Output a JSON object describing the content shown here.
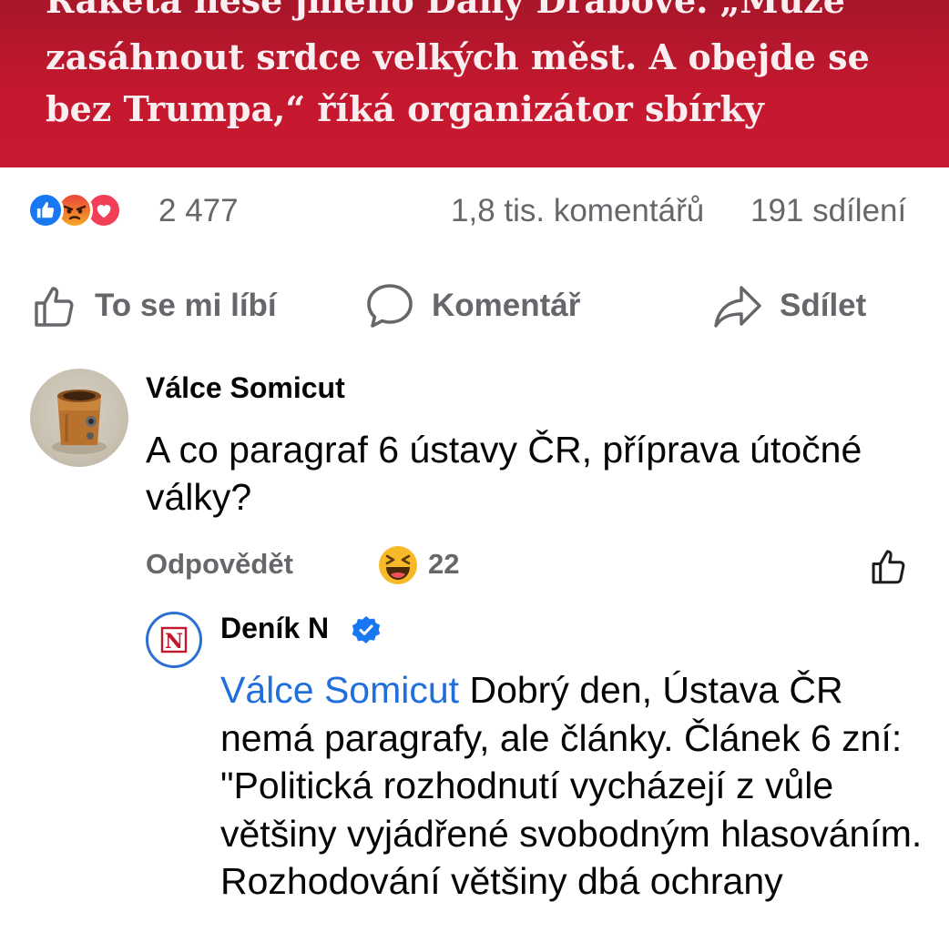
{
  "headline": {
    "lines": [
      "Raketa nese jméno Dany Drábové. „Může",
      "zasáhnout srdce velkých měst. A obejde se",
      "bez Trumpa,“ říká organizátor sbírky"
    ]
  },
  "post_stats": {
    "reaction_icons": [
      "like-icon",
      "angry-icon",
      "love-icon"
    ],
    "reaction_count": "2 477",
    "comments": "1,8 tis. komentářů",
    "shares": "191 sdílení"
  },
  "actions": {
    "like": "To se mi líbí",
    "comment": "Komentář",
    "share": "Sdílet"
  },
  "comment1": {
    "author": "Válce Somicut",
    "text": "A co paragraf 6 ústavy ČR, příprava útočné války?",
    "reply": "Odpovědět",
    "reaction_icon": "haha-icon",
    "reaction_count": "22"
  },
  "reply1": {
    "author": "Deník N",
    "verified": true,
    "mention": "Válce Somicut",
    "text": " Dobrý den, Ústava ČR nemá paragrafy, ale články. Článek 6 zní: \"Politická rozhodnutí vycházejí z vůle většiny vyjádřené svobodným hlasováním. Rozhodování většiny dbá ochrany"
  },
  "colors": {
    "banner": "#c4182e",
    "link": "#216fdb",
    "secondary_text": "#65676b",
    "like_blue": "#1877f2"
  }
}
